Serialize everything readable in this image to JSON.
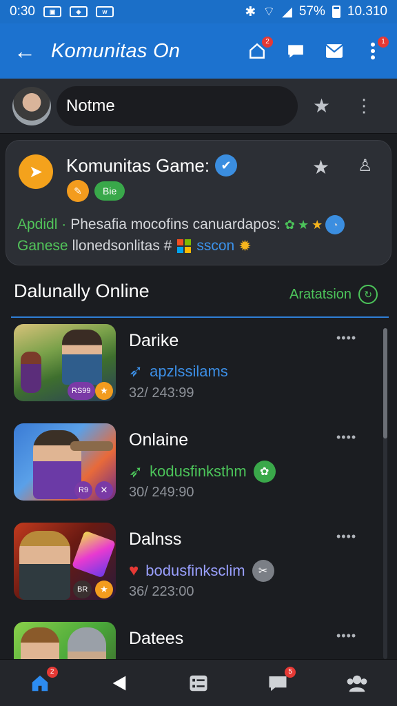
{
  "status_bar": {
    "time": "0:30",
    "icons": [
      "gallery-icon",
      "game-icon",
      "keyboard-icon"
    ],
    "battery": "57%",
    "clock": "10.310"
  },
  "app_bar": {
    "title": "Komunitas On",
    "actions": [
      {
        "icon": "home-icon",
        "badge": "2"
      },
      {
        "icon": "chat-icon",
        "badge": ""
      },
      {
        "icon": "mail-icon",
        "badge": ""
      },
      {
        "icon": "more-vertical-icon",
        "badge": "1"
      }
    ]
  },
  "profile": {
    "name": "Notme"
  },
  "community": {
    "title": "Komunitas Game:",
    "badge_label": "Bie",
    "line1_prefix": "Apdidl ·",
    "line1_text": "Phesafia mocofins canuardapos:",
    "line2_prefix": "Ganese",
    "line2_text": "llonedsonlitas #",
    "line2_link": "sscon"
  },
  "section": {
    "title": "Dalunally Online",
    "action": "Aratatsion"
  },
  "items": [
    {
      "title": "Darike",
      "subtitle": "apzlssilams",
      "meta": "32/ 243:99",
      "chip": "RS99",
      "sub_color": "#3c8fe6",
      "end_color": "",
      "end_icon": ""
    },
    {
      "title": "Onlaine",
      "subtitle": "kodusfinksthm",
      "meta": "30/ 249:90",
      "chip": "R9",
      "sub_color": "#4cc45a",
      "end_color": "#3aa84a",
      "end_icon": "flower-icon"
    },
    {
      "title": "Dalnss",
      "subtitle": "bodusfinksclim",
      "meta": "36/ 223:00",
      "chip": "BR",
      "sub_color": "#9aa0ff",
      "end_color": "#7b7f86",
      "end_icon": "tag-icon"
    },
    {
      "title": "Datees",
      "subtitle": "",
      "meta": "",
      "chip": "",
      "sub_color": "#ffffff",
      "end_color": "",
      "end_icon": ""
    }
  ],
  "bottom_nav": [
    {
      "icon": "home-icon",
      "badge": "2",
      "active": true
    },
    {
      "icon": "back-icon",
      "badge": "",
      "active": false
    },
    {
      "icon": "list-icon",
      "badge": "",
      "active": false
    },
    {
      "icon": "message-icon",
      "badge": "5",
      "active": false
    },
    {
      "icon": "group-icon",
      "badge": "",
      "active": false
    }
  ]
}
